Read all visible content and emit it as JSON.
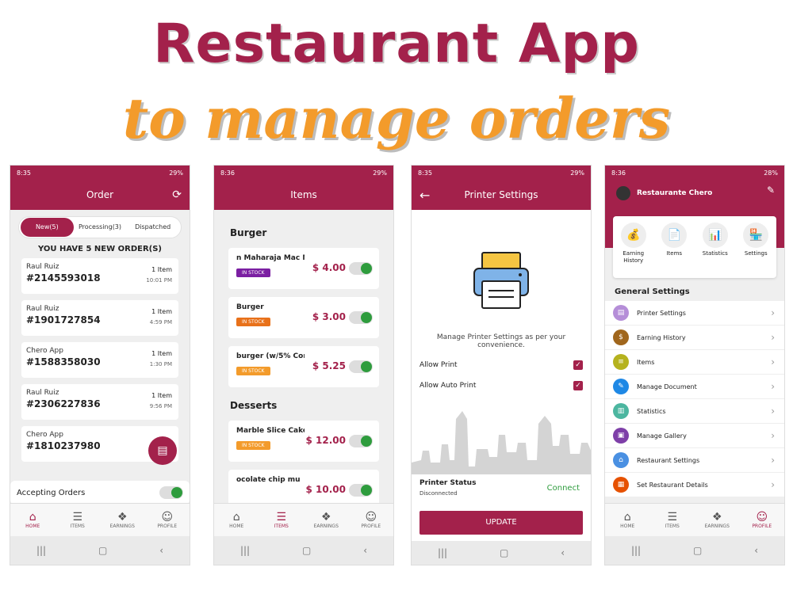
{
  "title_line1": "Restaurant App",
  "title_line2": "to manage orders",
  "colors": {
    "brand": "#a3214b",
    "accent": "#f39b2b",
    "stock": "#2e9c3d"
  },
  "screens": {
    "orders": {
      "status_time": "8:35",
      "status_right": "29%",
      "title": "Order",
      "tabs": [
        "New(5)",
        "Processing(3)",
        "Dispatched"
      ],
      "heading": "YOU HAVE 5 NEW ORDER(S)",
      "orders": [
        {
          "name": "Raul Ruiz",
          "number": "#2145593018",
          "items": "1 Item",
          "time": "10:01 PM"
        },
        {
          "name": "Raul Ruiz",
          "number": "#1901727854",
          "items": "1 Item",
          "time": "4:59 PM"
        },
        {
          "name": "Chero App",
          "number": "#1588358030",
          "items": "1 Item",
          "time": "1:30 PM"
        },
        {
          "name": "Raul Ruiz",
          "number": "#2306227836",
          "items": "1 Item",
          "time": "9:56 PM"
        },
        {
          "name": "Chero App",
          "number": "#1810237980",
          "items": "",
          "time": "7:"
        }
      ],
      "accepting_label": "Accepting Orders"
    },
    "items": {
      "status_time": "8:36",
      "status_right": "29%",
      "title": "Items",
      "sections": [
        {
          "title": "Burger",
          "items": [
            {
              "name": "n Maharaja Mac M",
              "badge": "IN STOCK",
              "price": "$ 4.00"
            },
            {
              "name": "Burger",
              "badge": "IN STOCK",
              "price": "$ 3.00"
            },
            {
              "name": "burger (w/5% Cor",
              "badge": "IN STOCK",
              "price": "$ 5.25"
            }
          ]
        },
        {
          "title": "Desserts",
          "items": [
            {
              "name": "Marble Slice Cake",
              "badge": "IN STOCK",
              "price": "$ 12.00"
            },
            {
              "name": "ocolate chip mu",
              "badge": "",
              "price": "$ 10.00"
            }
          ]
        }
      ]
    },
    "printer": {
      "status_time": "8:35",
      "status_right": "29%",
      "title": "Printer Settings",
      "message": "Manage Printer Settings as per your convenience.",
      "allow_print": "Allow Print",
      "allow_auto_print": "Allow Auto Print",
      "status_title": "Printer Status",
      "status_value": "Disconnected",
      "connect": "Connect",
      "update": "UPDATE"
    },
    "profile": {
      "status_time": "8:36",
      "status_right": "28%",
      "restaurant_name": "Restaurante Chero",
      "quick": [
        "Earning History",
        "Items",
        "Statistics",
        "Settings"
      ],
      "general_title": "General Settings",
      "settings": [
        "Printer Settings",
        "Earning History",
        "Items",
        "Manage Document",
        "Statistics",
        "Manage Gallery",
        "Restaurant Settings",
        "Set Restaurant Details"
      ]
    }
  },
  "nav": [
    "HOME",
    "ITEMS",
    "EARNINGS",
    "PROFILE"
  ]
}
